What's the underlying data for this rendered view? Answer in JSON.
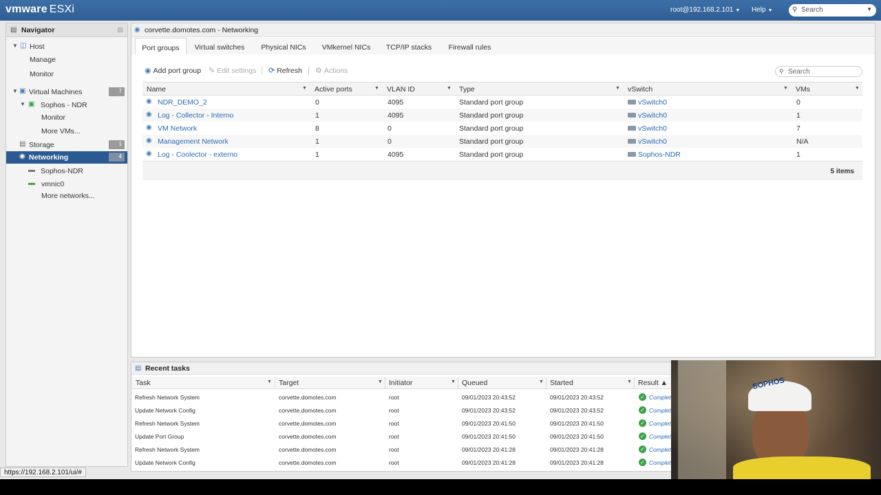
{
  "header": {
    "brand_vm": "vmware",
    "brand_product": "ESXi",
    "user": "root@192.168.2.101",
    "help": "Help",
    "search_placeholder": "Search"
  },
  "navigator": {
    "title": "Navigator",
    "items": [
      {
        "label": "Host",
        "icon": "host-icon"
      },
      {
        "label": "Manage"
      },
      {
        "label": "Monitor"
      },
      {
        "label": "Virtual Machines",
        "icon": "vm-icon",
        "count": "7"
      },
      {
        "label": "Sophos - NDR",
        "icon": "vm-icon"
      },
      {
        "label": "Monitor"
      },
      {
        "label": "More VMs..."
      },
      {
        "label": "Storage",
        "icon": "storage-icon",
        "count": "1"
      },
      {
        "label": "Networking",
        "icon": "network-icon",
        "count": "4",
        "selected": true
      },
      {
        "label": "Sophos-NDR",
        "icon": "switch-icon"
      },
      {
        "label": "vmnic0",
        "icon": "nic-icon"
      },
      {
        "label": "More networks..."
      }
    ]
  },
  "main": {
    "title": "corvette.domotes.com - Networking",
    "tabs": [
      "Port groups",
      "Virtual switches",
      "Physical NICs",
      "VMkernel NICs",
      "TCP/IP stacks",
      "Firewall rules"
    ],
    "active_tab": "Port groups",
    "toolbar": {
      "add": "Add port group",
      "edit": "Edit settings",
      "refresh": "Refresh",
      "actions": "Actions",
      "search_placeholder": "Search"
    },
    "columns": [
      "Name",
      "Active ports",
      "VLAN ID",
      "Type",
      "vSwitch",
      "VMs"
    ],
    "rows": [
      {
        "name": "NDR_DEMO_2",
        "active_ports": "0",
        "vlan": "4095",
        "type": "Standard port group",
        "vswitch": "vSwitch0",
        "vms": "0"
      },
      {
        "name": "Log - Collector - Interno",
        "active_ports": "1",
        "vlan": "4095",
        "type": "Standard port group",
        "vswitch": "vSwitch0",
        "vms": "1"
      },
      {
        "name": "VM Network",
        "active_ports": "8",
        "vlan": "0",
        "type": "Standard port group",
        "vswitch": "vSwitch0",
        "vms": "7"
      },
      {
        "name": "Management Network",
        "active_ports": "1",
        "vlan": "0",
        "type": "Standard port group",
        "vswitch": "vSwitch0",
        "vms": "N/A"
      },
      {
        "name": "Log - Coolector - externo",
        "active_ports": "1",
        "vlan": "4095",
        "type": "Standard port group",
        "vswitch": "Sophos-NDR",
        "vms": "1"
      }
    ],
    "items_count": "5 items"
  },
  "tasks": {
    "title": "Recent tasks",
    "columns": [
      "Task",
      "Target",
      "Initiator",
      "Queued",
      "Started",
      "Result ▲"
    ],
    "rows": [
      {
        "task": "Refresh Network System",
        "target": "corvette.domotes.com",
        "initiator": "root",
        "queued": "09/01/2023 20:43:52",
        "started": "09/01/2023 20:43:52",
        "result": "Complete"
      },
      {
        "task": "Update Network Config",
        "target": "corvette.domotes.com",
        "initiator": "root",
        "queued": "09/01/2023 20:43:52",
        "started": "09/01/2023 20:43:52",
        "result": "Complete"
      },
      {
        "task": "Refresh Network System",
        "target": "corvette.domotes.com",
        "initiator": "root",
        "queued": "09/01/2023 20:41:50",
        "started": "09/01/2023 20:41:50",
        "result": "Complete"
      },
      {
        "task": "Update Port Group",
        "target": "corvette.domotes.com",
        "initiator": "root",
        "queued": "09/01/2023 20:41:50",
        "started": "09/01/2023 20:41:50",
        "result": "Complete"
      },
      {
        "task": "Refresh Network System",
        "target": "corvette.domotes.com",
        "initiator": "root",
        "queued": "09/01/2023 20:41:28",
        "started": "09/01/2023 20:41:28",
        "result": "Complete"
      },
      {
        "task": "Update Network Config",
        "target": "corvette.domotes.com",
        "initiator": "root",
        "queued": "09/01/2023 20:41:28",
        "started": "09/01/2023 20:41:28",
        "result": "Complete"
      }
    ]
  },
  "status_url": "https://192.168.2.101/ui/#",
  "webcam": {
    "cap_text": "SOPHOS"
  },
  "colors": {
    "header": "#2f5e94",
    "selected": "#2b5a93",
    "link": "#2a6ab3",
    "success": "#3aa34a"
  }
}
